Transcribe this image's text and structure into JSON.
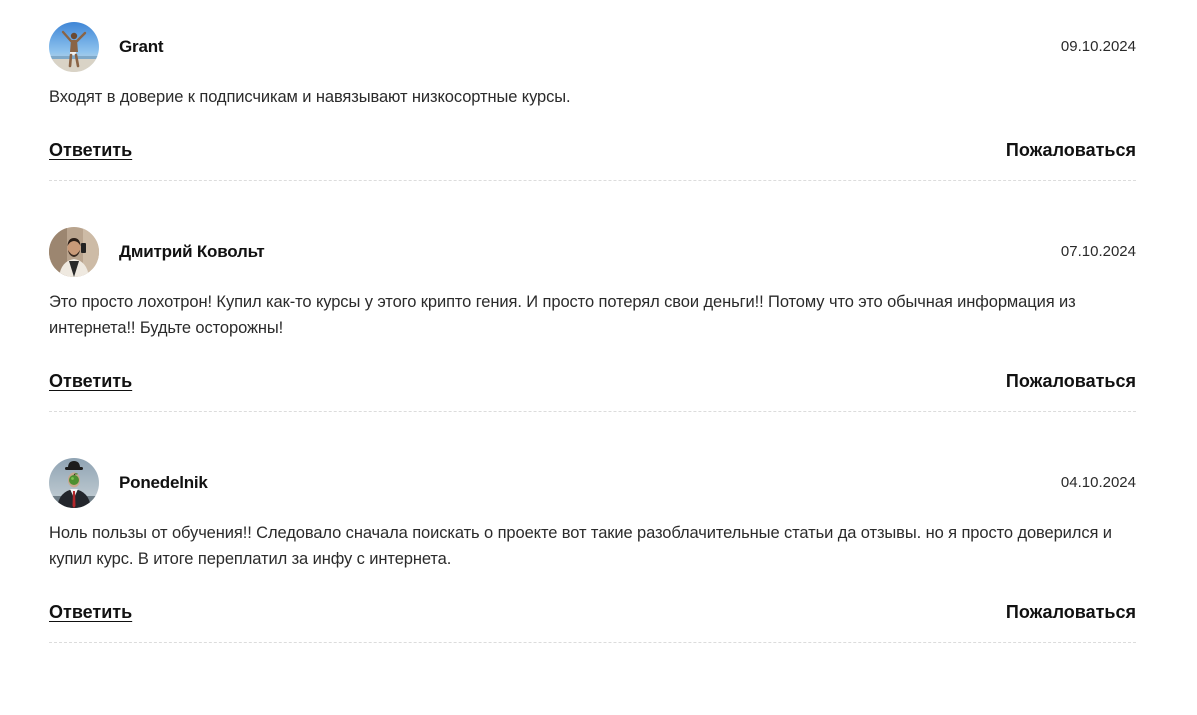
{
  "comments": [
    {
      "author": "Grant",
      "date": "09.10.2024",
      "text": "Входят в доверие к подписчикам и навязывают низкосортные курсы.",
      "reply_label": "Ответить",
      "report_label": "Пожаловаться",
      "avatar_icon": "person-beach-photo"
    },
    {
      "author": "Дмитрий Ковольт",
      "date": "07.10.2024",
      "text": "Это просто лохотрон! Купил как-то курсы у этого крипто гения. И просто потерял свои деньги!! Потому что это обычная информация из интернета!! Будьте осторожны!",
      "reply_label": "Ответить",
      "report_label": "Пожаловаться",
      "avatar_icon": "person-selfie-photo"
    },
    {
      "author": "Ponedelnik",
      "date": "04.10.2024",
      "text": "Ноль пользы от обучения!! Следовало сначала поискать о проекте вот такие разоблачительные статьи да отзывы. но я просто доверился и купил курс. В итоге переплатил за инфу с интернета.",
      "reply_label": "Ответить",
      "report_label": "Пожаловаться",
      "avatar_icon": "son-of-man-painting"
    }
  ],
  "colors": {
    "text": "#2b2b2b",
    "heading": "#111111",
    "divider": "#dcdcdc",
    "background": "#ffffff"
  }
}
